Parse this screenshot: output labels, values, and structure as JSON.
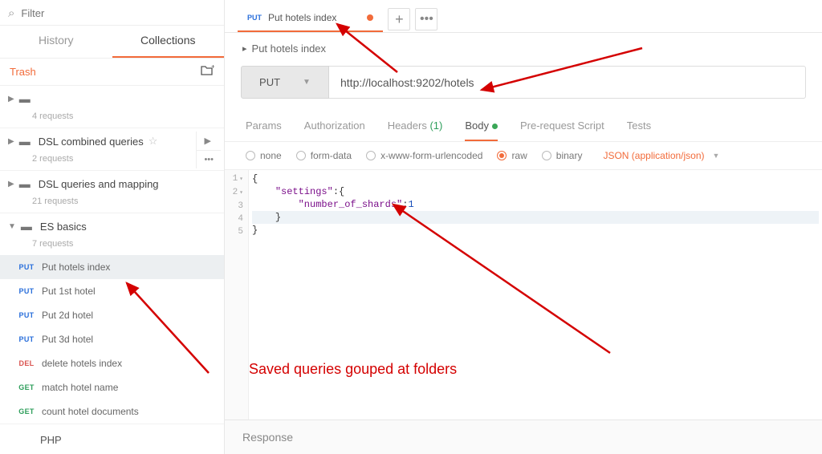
{
  "search": {
    "placeholder": "Filter"
  },
  "tabs": {
    "history": "History",
    "collections": "Collections"
  },
  "trash": "Trash",
  "folders": [
    {
      "name": "",
      "sub": "4 requests",
      "expanded": false,
      "star": false,
      "actions": false
    },
    {
      "name": "DSL combined queries",
      "sub": "2 requests",
      "expanded": false,
      "star": true,
      "actions": true
    },
    {
      "name": "DSL queries and mapping",
      "sub": "21 requests",
      "expanded": false,
      "star": false,
      "actions": false
    },
    {
      "name": "ES basics",
      "sub": "7 requests",
      "expanded": true,
      "star": false,
      "actions": false
    }
  ],
  "requests": [
    {
      "method": "PUT",
      "cls": "m-put",
      "name": "Put hotels index",
      "selected": true
    },
    {
      "method": "PUT",
      "cls": "m-put",
      "name": "Put 1st hotel",
      "selected": false
    },
    {
      "method": "PUT",
      "cls": "m-put",
      "name": "Put 2d hotel",
      "selected": false
    },
    {
      "method": "PUT",
      "cls": "m-put",
      "name": "Put 3d hotel",
      "selected": false
    },
    {
      "method": "DEL",
      "cls": "m-del",
      "name": "delete hotels index",
      "selected": false
    },
    {
      "method": "GET",
      "cls": "m-get",
      "name": "match hotel name",
      "selected": false
    },
    {
      "method": "GET",
      "cls": "m-get",
      "name": "count hotel documents",
      "selected": false
    }
  ],
  "php_item": "PHP",
  "main": {
    "tab_method": "PUT",
    "tab_name": "Put hotels index",
    "breadcrumb": "Put hotels index",
    "method": "PUT",
    "url": "http://localhost:9202/hotels",
    "subtabs": {
      "params": "Params",
      "authorization": "Authorization",
      "headers": "Headers",
      "headers_count": "(1)",
      "body": "Body",
      "prerequest": "Pre-request Script",
      "tests": "Tests"
    },
    "body_types": {
      "none": "none",
      "form": "form-data",
      "xwww": "x-www-form-urlencoded",
      "raw": "raw",
      "binary": "binary"
    },
    "content_type": "JSON (application/json)",
    "code_lines": [
      "{",
      "    \"settings\":{",
      "        \"number_of_shards\":1",
      "    }",
      "}"
    ],
    "response": "Response"
  },
  "annotation": "Saved queries gouped at folders"
}
